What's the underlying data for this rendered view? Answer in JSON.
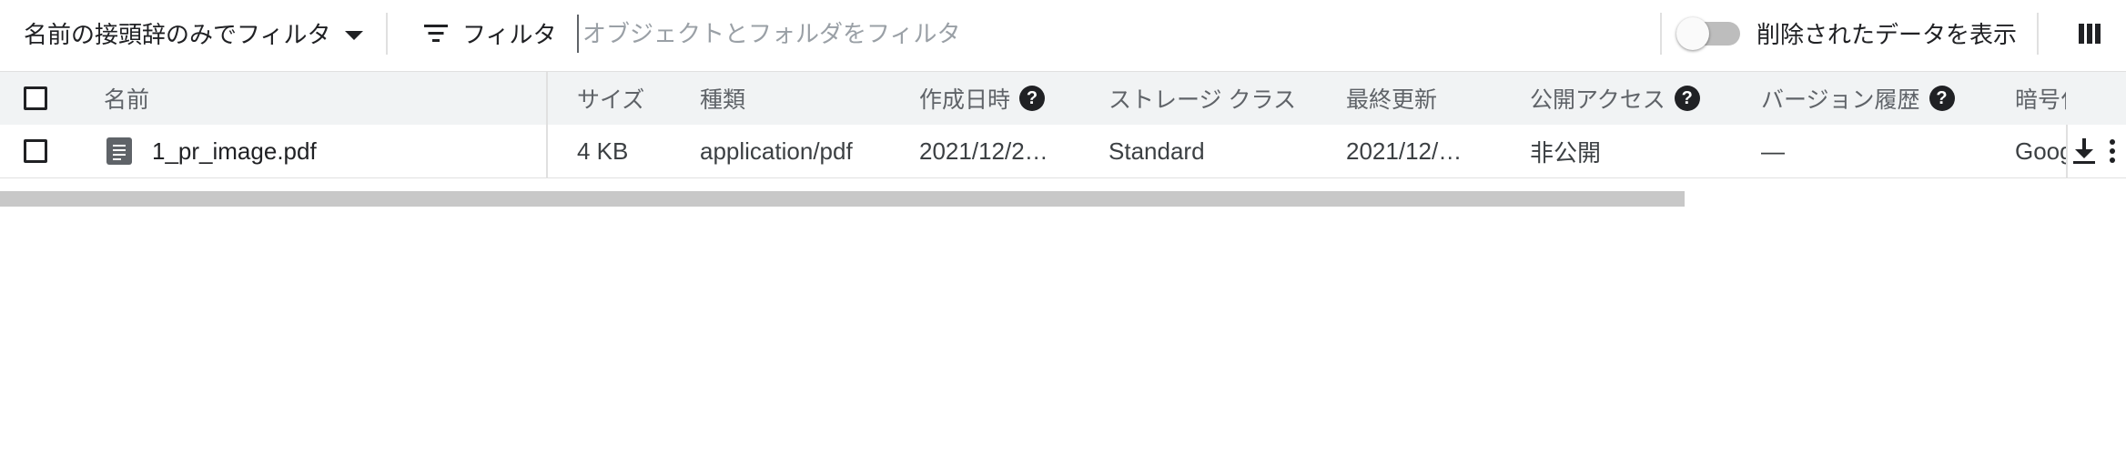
{
  "toolbar": {
    "name_filter_label": "名前の接頭辞のみでフィルタ",
    "filter_label": "フィルタ",
    "filter_placeholder": "オブジェクトとフォルダをフィルタ",
    "show_deleted_label": "削除されたデータを表示",
    "show_deleted_on": false
  },
  "table": {
    "headers": {
      "name": "名前",
      "size": "サイズ",
      "type": "種類",
      "created": "作成日時",
      "storage_class": "ストレージ クラス",
      "updated": "最終更新",
      "public_access": "公開アクセス",
      "version_history": "バージョン履歴",
      "encryption": "暗号化"
    },
    "help_glyph": "?",
    "rows": [
      {
        "name": "1_pr_image.pdf",
        "size": "4 KB",
        "type": "application/pdf",
        "created": "2021/12/2…",
        "storage_class": "Standard",
        "updated": "2021/12/…",
        "public_access": "非公開",
        "version_history": "—",
        "encryption": "Google"
      }
    ]
  },
  "icons": {
    "filter": "filter-list-icon",
    "caret": "arrow-drop-down-icon",
    "file": "document-icon",
    "download": "download-icon",
    "more": "more-vert-icon",
    "columns": "column-view-icon",
    "help": "help-icon"
  }
}
